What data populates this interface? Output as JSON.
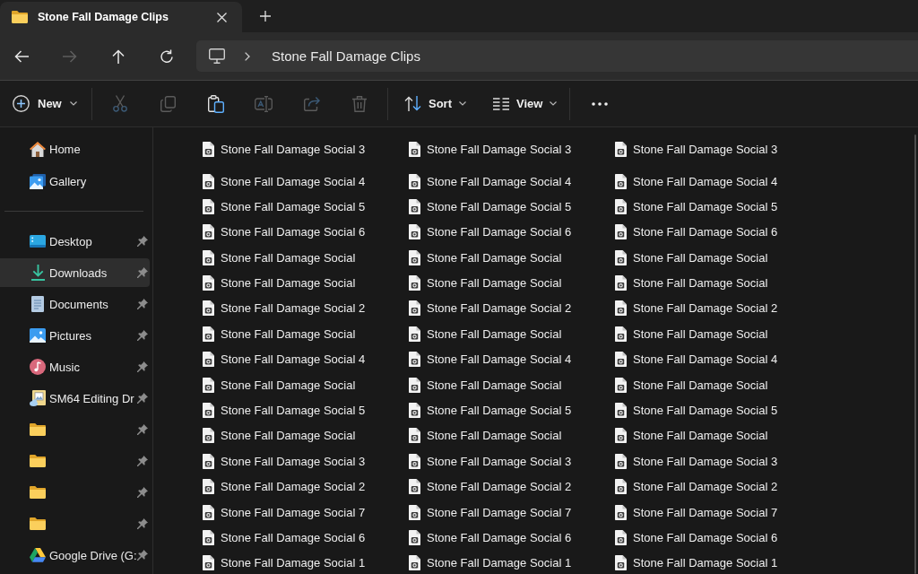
{
  "tabs": [
    {
      "title": "Stone Fall Damage Clips",
      "selected": true
    }
  ],
  "navigation": [
    {
      "disabled": false
    },
    {
      "disabled": true
    },
    {
      "disabled": false
    },
    {
      "disabled": false
    }
  ],
  "address_bar": {
    "breadcrumbs": [
      "Stone Fall Damage Clips"
    ]
  },
  "command_bar": {
    "new_label": "New",
    "actions": [
      {
        "disabled": true
      },
      {
        "disabled": true
      },
      {
        "disabled": false
      },
      {
        "disabled": true
      },
      {
        "disabled": true
      },
      {
        "disabled": true
      }
    ],
    "sort_label": "Sort",
    "view_label": "View"
  },
  "sidebar": {
    "top_items": [
      {
        "label": "Home",
        "selected": false
      },
      {
        "label": "Gallery",
        "selected": false
      }
    ],
    "items": [
      {
        "label": "Desktop",
        "pinned": true,
        "selected": false
      },
      {
        "label": "Downloads",
        "pinned": true,
        "selected": true
      },
      {
        "label": "Documents",
        "pinned": true,
        "selected": false
      },
      {
        "label": "Pictures",
        "pinned": true,
        "selected": false
      },
      {
        "label": "Music",
        "pinned": true,
        "selected": false
      },
      {
        "label": "SM64 Editing Dr",
        "pinned": true,
        "selected": false
      },
      {
        "pinned": true,
        "selected": false
      },
      {
        "pinned": true,
        "selected": false
      },
      {
        "pinned": true,
        "selected": false
      },
      {
        "pinned": true,
        "selected": false
      },
      {
        "label": "Google Drive (G:",
        "pinned": true,
        "selected": false
      }
    ]
  },
  "file_list": {
    "columns": [
      [
        {
          "name": "Stone Fall Damage Social 3",
          "selected": false
        },
        {
          "name": "Stone Fall Damage Social 4",
          "selected": false
        },
        {
          "name": "Stone Fall Damage Social 5",
          "selected": false
        },
        {
          "name": "Stone Fall Damage Social 6",
          "selected": false
        },
        {
          "name": "Stone Fall Damage Social",
          "selected": false
        },
        {
          "name": "Stone Fall Damage Social",
          "selected": false
        },
        {
          "name": "Stone Fall Damage Social 2",
          "selected": false
        },
        {
          "name": "Stone Fall Damage Social",
          "selected": false
        },
        {
          "name": "Stone Fall Damage Social 4",
          "selected": false
        },
        {
          "name": "Stone Fall Damage Social",
          "selected": false
        },
        {
          "name": "Stone Fall Damage Social 5",
          "selected": false
        },
        {
          "name": "Stone Fall Damage Social",
          "selected": false
        },
        {
          "name": "Stone Fall Damage Social 3",
          "selected": false
        },
        {
          "name": "Stone Fall Damage Social 2",
          "selected": false
        },
        {
          "name": "Stone Fall Damage Social 7",
          "selected": false
        },
        {
          "name": "Stone Fall Damage Social 6",
          "selected": false
        },
        {
          "name": "Stone Fall Damage Social 1",
          "selected": false
        }
      ],
      [
        {
          "name": "Stone Fall Damage Social 3",
          "selected": false
        },
        {
          "name": "Stone Fall Damage Social 4",
          "selected": false
        },
        {
          "name": "Stone Fall Damage Social 5",
          "selected": false
        },
        {
          "name": "Stone Fall Damage Social 6",
          "selected": false
        },
        {
          "name": "Stone Fall Damage Social",
          "selected": false
        },
        {
          "name": "Stone Fall Damage Social",
          "selected": false
        },
        {
          "name": "Stone Fall Damage Social 2",
          "selected": false
        },
        {
          "name": "Stone Fall Damage Social",
          "selected": false
        },
        {
          "name": "Stone Fall Damage Social 4",
          "selected": false
        },
        {
          "name": "Stone Fall Damage Social",
          "selected": false
        },
        {
          "name": "Stone Fall Damage Social 5",
          "selected": false
        },
        {
          "name": "Stone Fall Damage Social",
          "selected": false
        },
        {
          "name": "Stone Fall Damage Social 3",
          "selected": false
        },
        {
          "name": "Stone Fall Damage Social 2",
          "selected": false
        },
        {
          "name": "Stone Fall Damage Social 7",
          "selected": false
        },
        {
          "name": "Stone Fall Damage Social 6",
          "selected": false
        },
        {
          "name": "Stone Fall Damage Social 1",
          "selected": false
        }
      ],
      [
        {
          "name": "Stone Fall Damage Social 3",
          "selected": false
        },
        {
          "name": "Stone Fall Damage Social 4",
          "selected": false
        },
        {
          "name": "Stone Fall Damage Social 5",
          "selected": false
        },
        {
          "name": "Stone Fall Damage Social 6",
          "selected": false
        },
        {
          "name": "Stone Fall Damage Social",
          "selected": false
        },
        {
          "name": "Stone Fall Damage Social",
          "selected": false
        },
        {
          "name": "Stone Fall Damage Social 2",
          "selected": false
        },
        {
          "name": "Stone Fall Damage Social",
          "selected": false
        },
        {
          "name": "Stone Fall Damage Social 4",
          "selected": false
        },
        {
          "name": "Stone Fall Damage Social",
          "selected": false
        },
        {
          "name": "Stone Fall Damage Social 5",
          "selected": false
        },
        {
          "name": "Stone Fall Damage Social",
          "selected": false
        },
        {
          "name": "Stone Fall Damage Social 3",
          "selected": false
        },
        {
          "name": "Stone Fall Damage Social 2",
          "selected": false
        },
        {
          "name": "Stone Fall Damage Social 7",
          "selected": false
        },
        {
          "name": "Stone Fall Damage Social 6",
          "selected": false
        },
        {
          "name": "Stone Fall Damage Social 1",
          "selected": false
        }
      ]
    ]
  }
}
